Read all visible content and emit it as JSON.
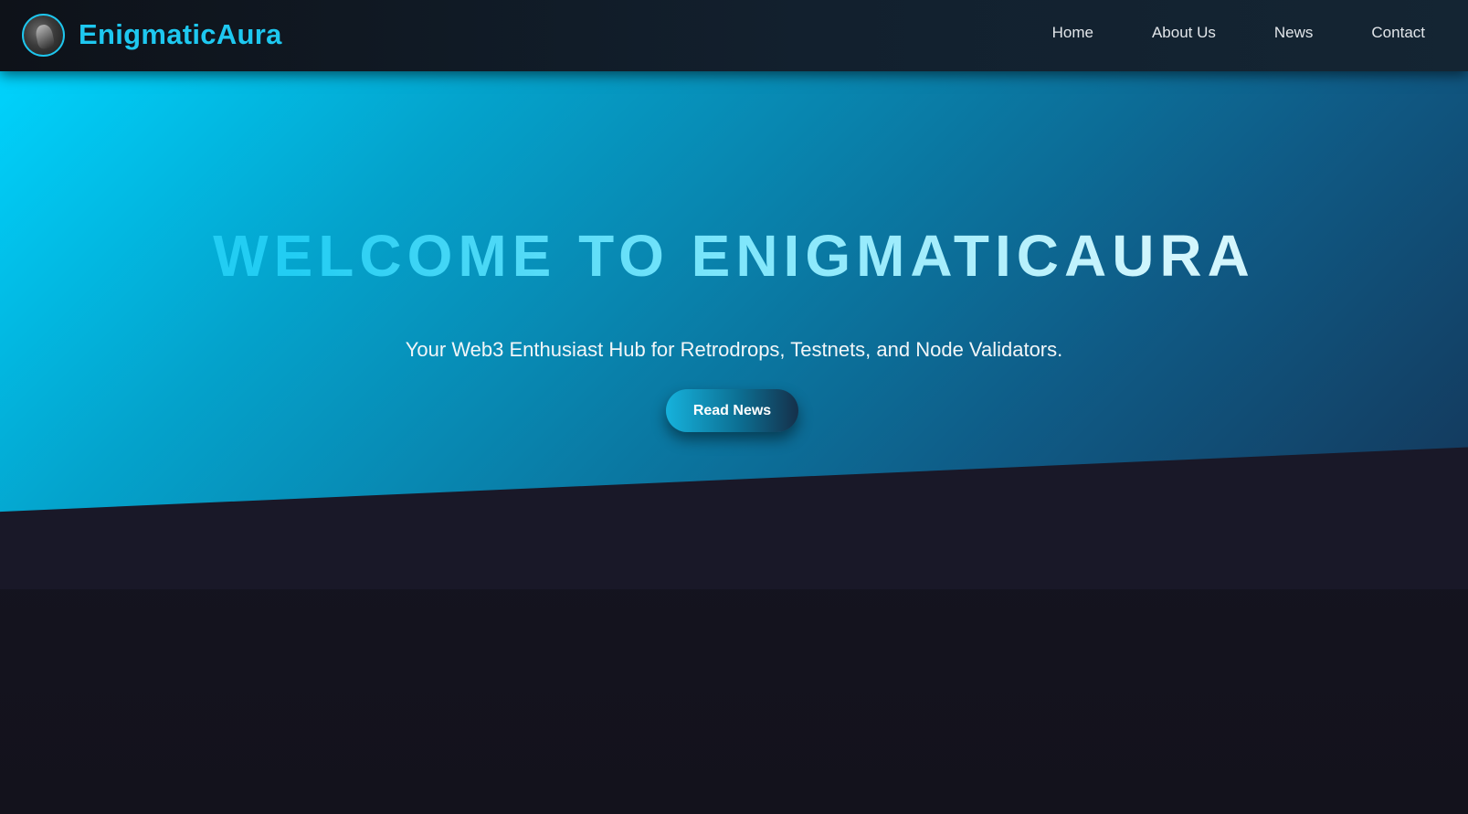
{
  "nav": {
    "brand_name": "EnigmaticAura",
    "avatar_icon": "profile-avatar",
    "links": [
      {
        "label": "Home"
      },
      {
        "label": "About Us"
      },
      {
        "label": "News"
      },
      {
        "label": "Contact"
      }
    ]
  },
  "hero": {
    "title": "WELCOME TO ENIGMATICAURA",
    "subtitle": "Your Web3 Enthusiast Hub for Retrodrops, Testnets, and Node Validators.",
    "cta_label": "Read News"
  },
  "colors": {
    "accent": "#1ec8f0",
    "hero_gradient_start": "#00d3fd",
    "hero_gradient_end": "#14375a",
    "background": "#13121d"
  }
}
